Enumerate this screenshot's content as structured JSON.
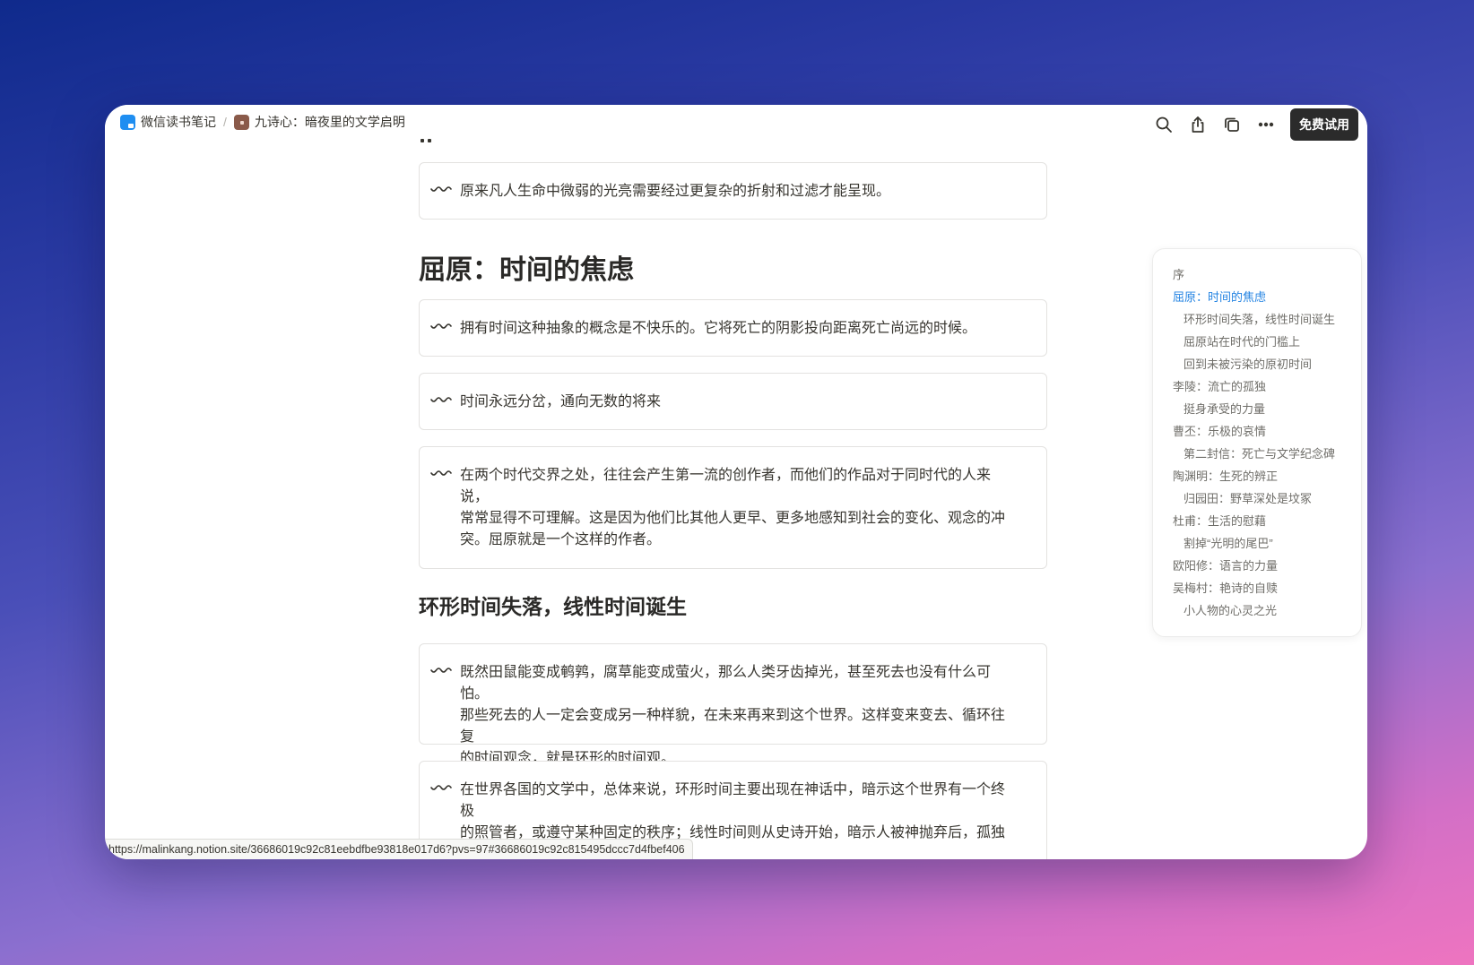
{
  "breadcrumb": {
    "workspace": "微信读书笔记",
    "page": "九诗心：暗夜里的文学启明"
  },
  "topbar": {
    "icons": [
      "search-icon",
      "share-icon",
      "duplicate-icon",
      "more-icon"
    ],
    "trial_label": "免费试用"
  },
  "content": {
    "quote_top": "原来凡人生命中微弱的光亮需要经过更复杂的折射和过滤才能呈现。",
    "heading1": "屈原：时间的焦虑",
    "quote1": "拥有时间这种抽象的概念是不快乐的。它将死亡的阴影投向距离死亡尚远的时候。",
    "quote2": "时间永远分岔，通向无数的将来",
    "quote3_lines": [
      "在两个时代交界之处，往往会产生第一流的创作者，而他们的作品对于同时代的人来说，",
      "常常显得不可理解。这是因为他们比其他人更早、更多地感知到社会的变化、观念的冲",
      "突。屈原就是一个这样的作者。"
    ],
    "heading2": "环形时间失落，线性时间诞生",
    "quote4_lines": [
      "既然田鼠能变成鹌鹑，腐草能变成萤火，那么人类牙齿掉光，甚至死去也没有什么可怕。",
      "那些死去的人一定会变成另一种样貌，在未来再来到这个世界。这样变来变去、循环往复",
      "的时间观念，就是环形的时间观。"
    ],
    "quote5_lines": [
      "在世界各国的文学中，总体来说，环形时间主要出现在神话中，暗示这个世界有一个终极",
      "的照管者，或遵守某种固定的秩序；线性时间则从史诗开始，暗示人被神抛弃后，孤独无"
    ]
  },
  "toc": [
    {
      "label": "序",
      "level": 1,
      "active": false
    },
    {
      "label": "屈原：时间的焦虑",
      "level": 1,
      "active": true
    },
    {
      "label": "环形时间失落，线性时间诞生",
      "level": 2,
      "active": false
    },
    {
      "label": "屈原站在时代的门槛上",
      "level": 2,
      "active": false
    },
    {
      "label": "回到未被污染的原初时间",
      "level": 2,
      "active": false
    },
    {
      "label": "李陵：流亡的孤独",
      "level": 1,
      "active": false
    },
    {
      "label": "挺身承受的力量",
      "level": 2,
      "active": false
    },
    {
      "label": "曹丕：乐极的哀情",
      "level": 1,
      "active": false
    },
    {
      "label": "第二封信：死亡与文学纪念碑",
      "level": 2,
      "active": false
    },
    {
      "label": "陶渊明：生死的辨正",
      "level": 1,
      "active": false
    },
    {
      "label": "归园田：野草深处是坟冢",
      "level": 2,
      "active": false
    },
    {
      "label": "杜甫：生活的慰藉",
      "level": 1,
      "active": false
    },
    {
      "label": "割掉“光明的尾巴”",
      "level": 2,
      "active": false
    },
    {
      "label": "欧阳修：语言的力量",
      "level": 1,
      "active": false
    },
    {
      "label": "吴梅村：艳诗的自赎",
      "level": 1,
      "active": false
    },
    {
      "label": "小人物的心灵之光",
      "level": 2,
      "active": false
    }
  ],
  "status_url": "https://malinkang.notion.site/36686019c92c81eebdfbe93818e017d6?pvs=97#36686019c92c815495dccc7d4fbef406"
}
